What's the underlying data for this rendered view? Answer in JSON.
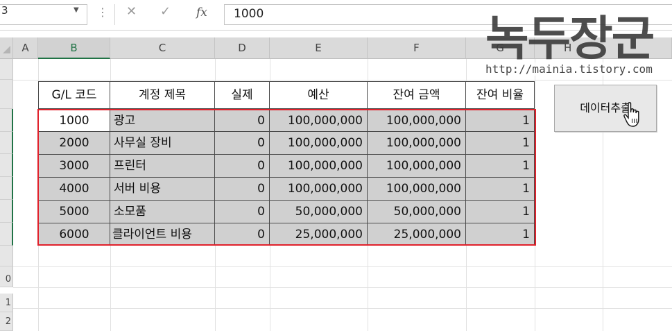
{
  "formula_bar": {
    "name_box": "3",
    "more_dots": "⋮",
    "cancel_icon": "✕",
    "enter_icon": "✓",
    "fx_label": "fx",
    "value": "1000"
  },
  "columns": [
    "A",
    "B",
    "C",
    "D",
    "E",
    "F",
    "G",
    "H"
  ],
  "rows": [
    "",
    "",
    "",
    "",
    "",
    "",
    "",
    "",
    "",
    "",
    "0",
    "1",
    "2"
  ],
  "table": {
    "headers": [
      "G/L 코드",
      "계정 제목",
      "실제",
      "예산",
      "잔여 금액",
      "잔여 비율"
    ],
    "rows": [
      [
        "1000",
        "광고",
        "0",
        "100,000,000",
        "100,000,000",
        "1"
      ],
      [
        "2000",
        "사무실 장비",
        "0",
        "100,000,000",
        "100,000,000",
        "1"
      ],
      [
        "3000",
        "프린터",
        "0",
        "100,000,000",
        "100,000,000",
        "1"
      ],
      [
        "4000",
        "서버 비용",
        "0",
        "100,000,000",
        "100,000,000",
        "1"
      ],
      [
        "5000",
        "소모품",
        "0",
        "50,000,000",
        "50,000,000",
        "1"
      ],
      [
        "6000",
        "클라이언트 비용",
        "0",
        "25,000,000",
        "25,000,000",
        "1"
      ]
    ]
  },
  "button": {
    "label": "데이터추출"
  },
  "watermark": {
    "title": "녹두장군",
    "url": "http://mainia.tistory.com"
  },
  "colors": {
    "selection_accent": "#217346",
    "highlight_box": "#e0202a",
    "data_fill": "#d0d0d0"
  }
}
